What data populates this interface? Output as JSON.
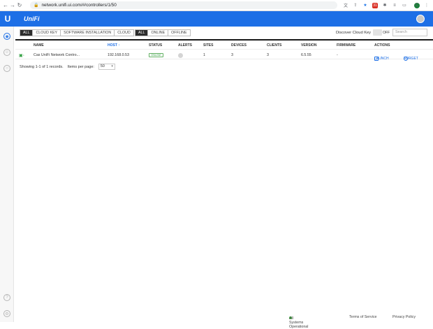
{
  "browser": {
    "url": "network.unifi.ui.com/#/controllers/1/50",
    "profile_initial": "C",
    "ext_badge": "31"
  },
  "app": {
    "logo": "UniFi",
    "brand_glyph": "U"
  },
  "filters": {
    "types": [
      {
        "label": "ALL",
        "active": true
      },
      {
        "label": "CLOUD KEY",
        "active": false
      },
      {
        "label": "SOFTWARE INSTALLATION",
        "active": false
      },
      {
        "label": "CLOUD",
        "active": false
      }
    ],
    "status": [
      {
        "label": "ALL",
        "active": true
      },
      {
        "label": "ONLINE",
        "active": false
      },
      {
        "label": "OFFLINE",
        "active": false
      }
    ],
    "discover_label": "Discover Cloud Key",
    "toggle_state": "OFF",
    "search_placeholder": "Search"
  },
  "table": {
    "headers": {
      "name": "NAME",
      "host": "HOST ↑",
      "status": "STATUS",
      "alerts": "ALERTS",
      "sites": "SITES",
      "devices": "DEVICES",
      "clients": "CLIENTS",
      "version": "VERSION",
      "firmware": "FIRMWARE",
      "actions": "ACTIONS"
    },
    "rows": [
      {
        "name": "Cas UniFi Network Contro...",
        "host": "192.168.0.53",
        "status": "ONLINE",
        "sites": "1",
        "devices": "3",
        "clients": "3",
        "version": "6.5.55",
        "firmware": "-",
        "launch": "LAUNCH",
        "forget": "FORGET"
      }
    ]
  },
  "pager": {
    "showing": "Showing 1-1 of 1 records.",
    "items_label": "Items per page:",
    "items_value": "50"
  },
  "footer": {
    "status": "All Systems Operational",
    "terms": "Terms of Service",
    "privacy": "Privacy Policy"
  },
  "colors": {
    "brand": "#1d6fe6",
    "online": "#2e9e3e"
  }
}
